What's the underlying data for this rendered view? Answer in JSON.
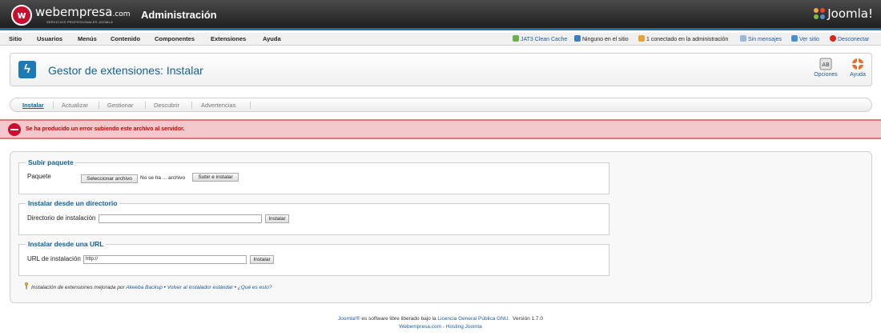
{
  "header": {
    "logo_mark": "w",
    "brand": "webempresa",
    "brand_suffix": ".com",
    "brand_tagline": "SERVICIOS PROFESIONALES JOOMLA",
    "title": "Administración",
    "joomla_logo": "Joomla!"
  },
  "menu": {
    "items": [
      "Sitio",
      "Usuarios",
      "Menús",
      "Contenido",
      "Componentes",
      "Extensiones",
      "Ayuda"
    ]
  },
  "status": {
    "cache": "JAT3 Clean Cache",
    "site_users": "Ninguno en el sitio",
    "admin_users": "1 conectado en la administración",
    "messages": "Sin mensajes",
    "view_site": "Ver sitio",
    "logout": "Desconectar"
  },
  "toolbar": {
    "page_title": "Gestor de extensiones: Instalar",
    "options_label": "Opciones",
    "help_label": "Ayuda"
  },
  "submenu": {
    "items": [
      "Instalar",
      "Actualizar",
      "Gestionar",
      "Descubrir",
      "Advertencias"
    ]
  },
  "error": {
    "message": "Se ha producido un error subiendo este archivo al servidor."
  },
  "upload": {
    "legend": "Subir paquete",
    "label": "Paquete",
    "choose_button": "Seleccionar archivo",
    "file_status": "No se ha ... archivo",
    "submit_button": "Subir e instalar"
  },
  "directory": {
    "legend": "Instalar desde un directorio",
    "label": "Directorio de instalación",
    "value": "",
    "submit_button": "Instalar"
  },
  "url": {
    "legend": "Instalar desde una URL",
    "label": "URL de instalación",
    "value": "http://",
    "submit_button": "Instalar"
  },
  "note": {
    "text": "Instalación de extensiones mejorada por",
    "akeeba_link": "Akeeba Backup",
    "sep1": "•",
    "standard_link": "Volver al instalador estándar",
    "sep2": "•",
    "what_link": "¿Qué es esto?"
  },
  "footer": {
    "prefix": "Joomla!®",
    "text": "es software libre liberado bajo la",
    "license_link": "Licencia General Pública GNU.",
    "version": "Versión 1.7.0",
    "hosting": "Webempresa.com - Hosting Joomla"
  },
  "colors": {
    "accent": "#146295",
    "error_bg": "#f3c8cd",
    "error_text": "#cc0000",
    "header_bg": "#2b2b2b"
  }
}
